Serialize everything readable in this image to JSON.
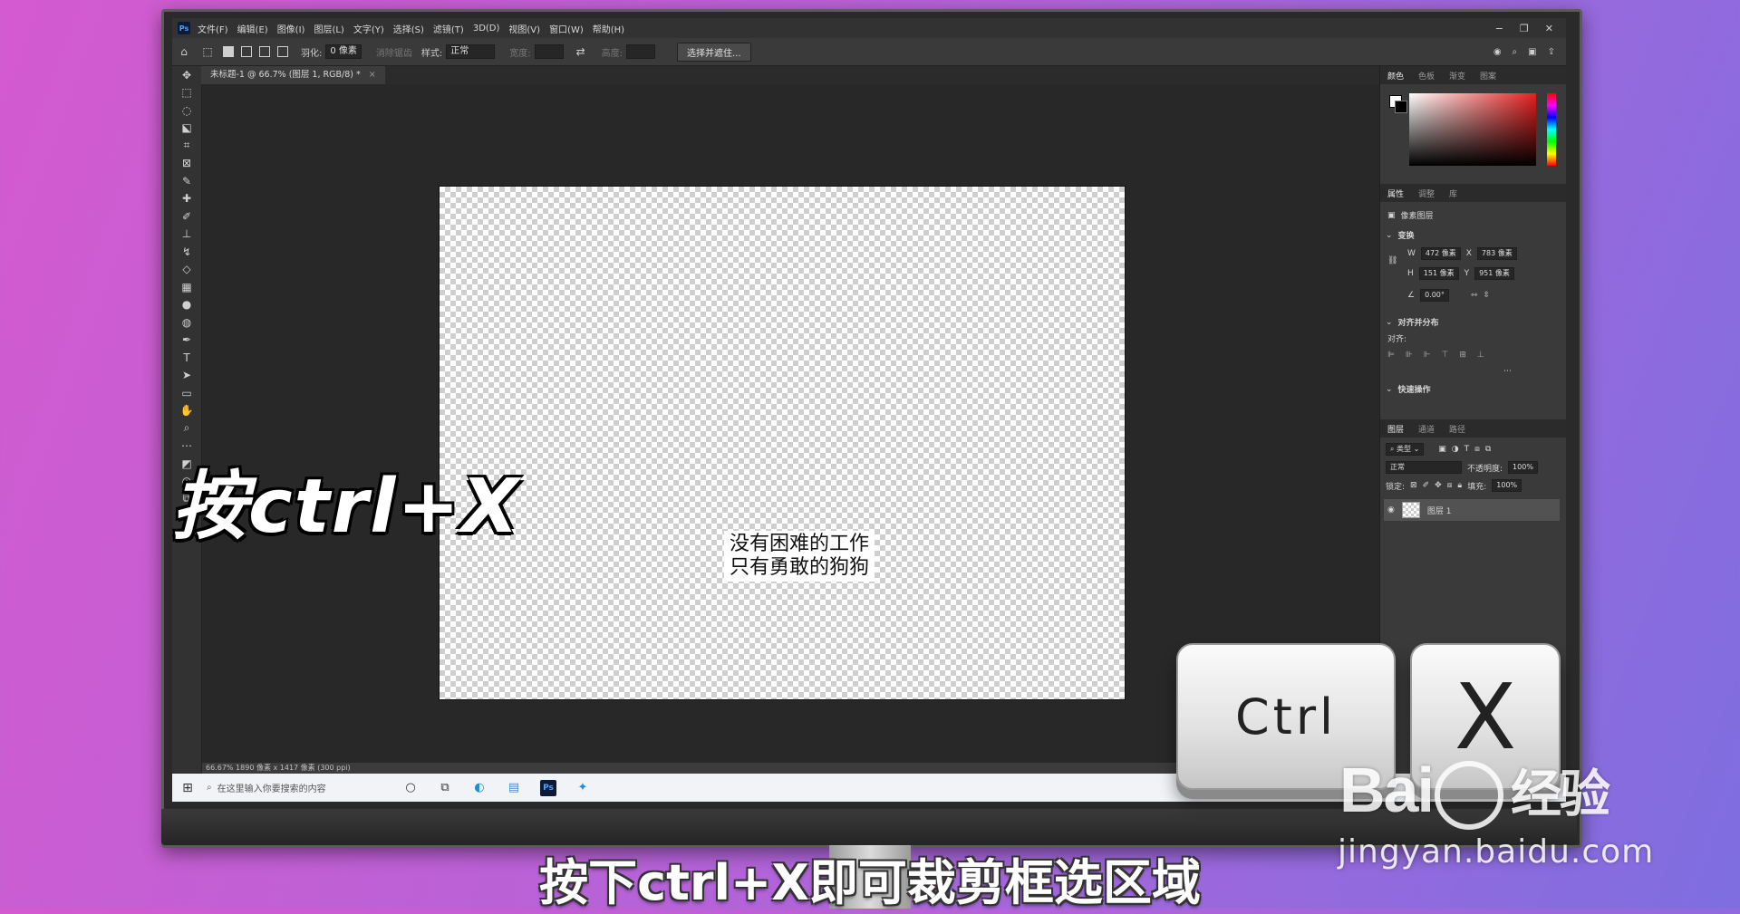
{
  "app": {
    "logo": "Ps",
    "menu": [
      "文件(F)",
      "编辑(E)",
      "图像(I)",
      "图层(L)",
      "文字(Y)",
      "选择(S)",
      "滤镜(T)",
      "3D(D)",
      "视图(V)",
      "窗口(W)",
      "帮助(H)"
    ],
    "window_controls": [
      "−",
      "❐",
      "✕"
    ]
  },
  "options": {
    "feather_label": "羽化:",
    "feather_value": "0 像素",
    "antialias_label": "消除锯齿",
    "style_label": "样式:",
    "style_value": "正常",
    "width_label": "宽度:",
    "height_label": "高度:",
    "select_mask_btn": "选择并遮住..."
  },
  "document": {
    "tab_title": "未标题-1 @ 66.7% (图层 1, RGB/8) *",
    "canvas_text_line1": "没有困难的工作",
    "canvas_text_line2": "只有勇敢的狗狗",
    "status": "66.67%   1890 像素 x 1417 像素 (300 ppi)"
  },
  "panels": {
    "color_tabs": [
      "颜色",
      "色板",
      "渐变",
      "图案"
    ],
    "prop_tabs": [
      "属性",
      "调整",
      "库"
    ],
    "pixel_layer_label": "像素图层",
    "transform_label": "变换",
    "w_label": "W",
    "w_value": "472 像素",
    "x_label": "X",
    "x_value": "783 像素",
    "h_label": "H",
    "h_value": "151 像素",
    "y_label": "Y",
    "y_value": "951 像素",
    "angle_value": "0.00°",
    "align_label": "对齐并分布",
    "align_sub": "对齐:",
    "quick_actions": "快速操作",
    "layer_tabs": [
      "图层",
      "通道",
      "路径"
    ],
    "kind_filter": "类型",
    "blend_mode": "正常",
    "opacity_label": "不透明度:",
    "opacity_value": "100%",
    "lock_label": "锁定:",
    "fill_label": "填充:",
    "fill_value": "100%",
    "layer_name": "图层 1"
  },
  "taskbar": {
    "search_placeholder": "在这里输入你要搜索的内容"
  },
  "overlay": {
    "left_caption": "按ctrl+X",
    "key_ctrl": "Ctrl",
    "key_x": "X",
    "subtitle": "按下ctrl+X即可裁剪框选区域"
  },
  "watermark": {
    "brand_a": "Bai",
    "brand_b": "经验",
    "url": "jingyan.baidu.com"
  }
}
